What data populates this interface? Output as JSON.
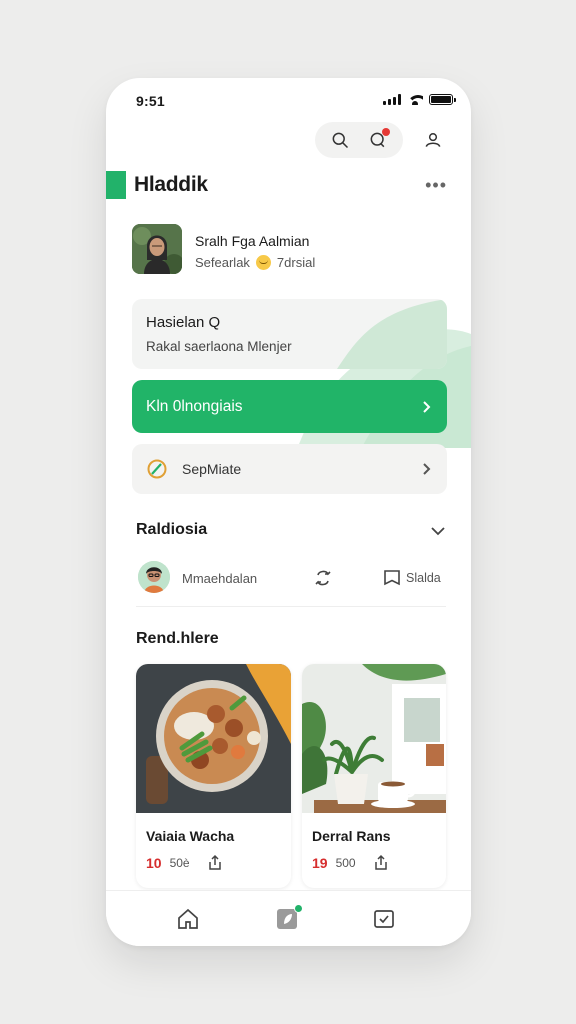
{
  "status_bar": {
    "time": "9:51"
  },
  "header": {
    "title": "Hladdik",
    "more_glyph": "•••"
  },
  "user": {
    "name": "Sralh Fga Aalmian",
    "status": "Sefearlak",
    "location": "7drsial"
  },
  "info_card": {
    "title": "Hasielan Q",
    "subtitle": "Rakal saerlaona Mlenjer"
  },
  "cta": {
    "label": "Kln 0lnongiais"
  },
  "row_item": {
    "label": "SepMiate"
  },
  "section_one": {
    "heading": "Raldiosia"
  },
  "activity": {
    "name": "Mmaehdalan",
    "save_label": "Slalda"
  },
  "section_two": {
    "heading": "Rend.hlere"
  },
  "posts": [
    {
      "title": "Vaiaia Wacha",
      "count": "10",
      "meta": "50è"
    },
    {
      "title": "Derral Rans",
      "count": "19",
      "meta": "500"
    }
  ],
  "colors": {
    "accent": "#21b468",
    "notification": "#e53935",
    "background": "#ededec"
  },
  "icons": {
    "topbar": [
      "search-icon",
      "chat-icon",
      "profile-icon"
    ],
    "tabbar": [
      "home-icon",
      "leaf-icon",
      "check-icon"
    ]
  }
}
